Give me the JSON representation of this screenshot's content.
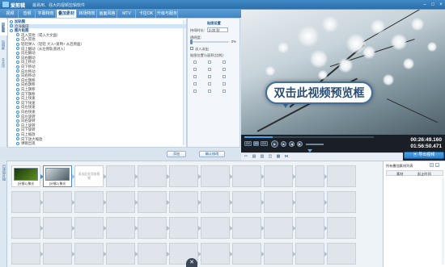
{
  "app": {
    "name": "爱剪辑",
    "slogan": "最易用、强大的视频剪辑软件",
    "window_controls": [
      "–",
      "□",
      "×"
    ]
  },
  "tabs": [
    "视频",
    "音频",
    "字幕特效",
    "叠加素材",
    "转场特效",
    "画面风格",
    "MTV",
    "卡拉OK",
    "升级与服务"
  ],
  "active_tab_index": 3,
  "sidebar": [
    "加贴图",
    "加相框",
    "去水印"
  ],
  "list": {
    "rows": [
      {
        "text": "加贴图",
        "style": "head"
      },
      {
        "text": "沧海桑田",
        "style": "sel"
      },
      {
        "text": "图片贴图",
        "style": "head"
      },
      {
        "text": "选入其他（或入大文面）",
        "style": "indent"
      },
      {
        "text": "选入其他",
        "style": "indent"
      },
      {
        "text": "轻轻弹入（轻轻 大入+爱哟+ 从后原面）",
        "style": "indent"
      },
      {
        "text": "向上翻动（从左侧轨道进入）",
        "style": "indent"
      },
      {
        "text": "向左翻动",
        "style": "indent"
      },
      {
        "text": "向右翻动",
        "style": "indent"
      },
      {
        "text": "向上移动",
        "style": "indent"
      },
      {
        "text": "向下移动",
        "style": "indent"
      },
      {
        "text": "向左移动",
        "style": "indent"
      },
      {
        "text": "向右移动",
        "style": "indent"
      },
      {
        "text": "向左飘移",
        "style": "indent"
      },
      {
        "text": "向右飘移",
        "style": "indent"
      },
      {
        "text": "向上飘移",
        "style": "indent"
      },
      {
        "text": "向下飘移",
        "style": "indent"
      },
      {
        "text": "向上快速",
        "style": "indent"
      },
      {
        "text": "向下快速",
        "style": "indent"
      },
      {
        "text": "向左快速",
        "style": "indent"
      },
      {
        "text": "向右快速",
        "style": "indent"
      },
      {
        "text": "向左旋转",
        "style": "indent"
      },
      {
        "text": "向右旋转",
        "style": "indent"
      },
      {
        "text": "向上旋转",
        "style": "indent"
      },
      {
        "text": "向下旋转",
        "style": "indent"
      },
      {
        "text": "向上缩放",
        "style": "indent"
      },
      {
        "text": "向下放大缩放",
        "style": "indent"
      },
      {
        "text": "弹跳出现",
        "style": "indent"
      }
    ]
  },
  "buttons": {
    "add": "添加",
    "confirm": "确认修改"
  },
  "props": {
    "title": "贴图设置",
    "duration_label": "持续时长：",
    "duration_value": "2.00 秒",
    "transparency_label": "透明度：",
    "transparency_value": "0%",
    "transparency_fraction": 0,
    "checkbox_label": "淡入淡出",
    "position_label": "贴图位置与面积(比例)："
  },
  "player": {
    "speed_buttons": [
      "2X",
      "1X",
      "2X"
    ],
    "time_current": "00:26:49.160",
    "time_total": "01:56:50.471",
    "export": "导出视频",
    "progress_fraction": 0.22
  },
  "preview": {
    "bubble": "双击此视频预览框"
  },
  "timeline": {
    "clips": [
      {
        "label": "[分镜1] 聚光"
      },
      {
        "label": "[分镜2] 聚光"
      }
    ],
    "placeholder_text": "双击此处添加视频"
  },
  "right_panel": {
    "title": "所有叠加素材列表",
    "columns": [
      "素材",
      "起止时间"
    ]
  }
}
